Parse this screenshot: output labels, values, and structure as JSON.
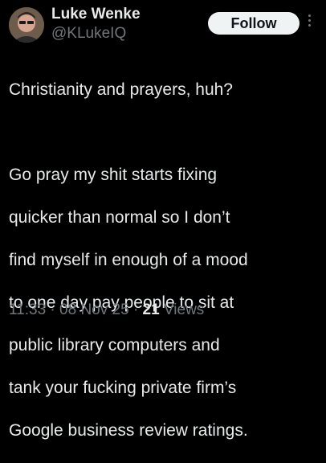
{
  "author": {
    "display_name": "Luke Wenke",
    "handle": "@KLukeIQ",
    "avatar_icon": "profile-photo"
  },
  "actions": {
    "follow_label": "Follow",
    "more_icon": "more-vertical-icon"
  },
  "tweet": {
    "line_1": "Christianity and prayers, huh?",
    "lines": [
      "Go pray my shit starts fixing",
      "quicker than normal so I don’t",
      "find myself in enough of a mood",
      "to one day pay people to sit at",
      "public library computers and",
      "tank your fucking private firm’s",
      "Google business review ratings."
    ]
  },
  "meta": {
    "time": "11:33",
    "separator": "·",
    "date": "08 Nov 25",
    "views_count": "21",
    "views_label": "Views"
  },
  "colors": {
    "background": "#000000",
    "text_primary": "#e7e9ea",
    "text_secondary": "#71767b",
    "follow_bg": "#eff3f4",
    "follow_text": "#0f1419"
  }
}
